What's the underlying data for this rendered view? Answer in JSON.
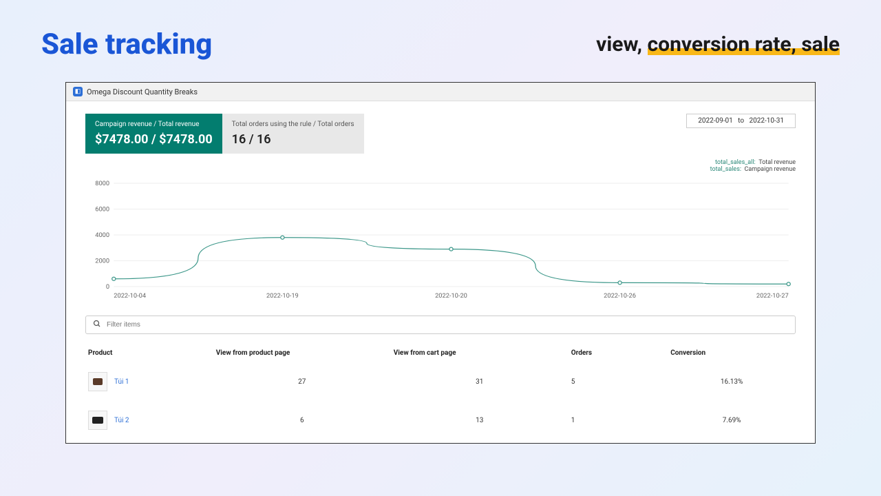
{
  "header": {
    "title": "Sale tracking",
    "subtitle_prefix": "view, ",
    "subtitle_highlight": "conversion rate, sale"
  },
  "app": {
    "name": "Omega Discount Quantity Breaks"
  },
  "stats": {
    "revenue_label": "Campaign revenue / Total revenue",
    "revenue_value": "$7478.00 / $7478.00",
    "orders_label": "Total orders using the rule / Total orders",
    "orders_value": "16 / 16"
  },
  "date_range": {
    "from": "2022-09-01",
    "sep": "to",
    "to": "2022-10-31"
  },
  "legend": {
    "key1": "total_sales_all:",
    "val1": "Total revenue",
    "key2": "total_sales:",
    "val2": "Campaign revenue"
  },
  "search": {
    "placeholder": "Filter items"
  },
  "table": {
    "headers": {
      "product": "Product",
      "view_product": "View from product page",
      "view_cart": "View from cart page",
      "orders": "Orders",
      "conversion": "Conversion"
    },
    "rows": [
      {
        "name": "Túi 1",
        "view_product": "27",
        "view_cart": "31",
        "orders": "5",
        "conversion": "16.13%"
      },
      {
        "name": "Túi 2",
        "view_product": "6",
        "view_cart": "13",
        "orders": "1",
        "conversion": "7.69%"
      }
    ]
  },
  "chart_data": {
    "type": "line",
    "title": "",
    "xlabel": "",
    "ylabel": "",
    "ylim": [
      0,
      8000
    ],
    "y_ticks": [
      0,
      2000,
      4000,
      6000,
      8000
    ],
    "categories": [
      "2022-10-04",
      "2022-10-19",
      "2022-10-20",
      "2022-10-26",
      "2022-10-27"
    ],
    "series": [
      {
        "name": "total_sales_all",
        "values": [
          600,
          3800,
          2900,
          300,
          200
        ]
      },
      {
        "name": "total_sales",
        "values": [
          600,
          3800,
          2900,
          300,
          200
        ]
      }
    ]
  }
}
